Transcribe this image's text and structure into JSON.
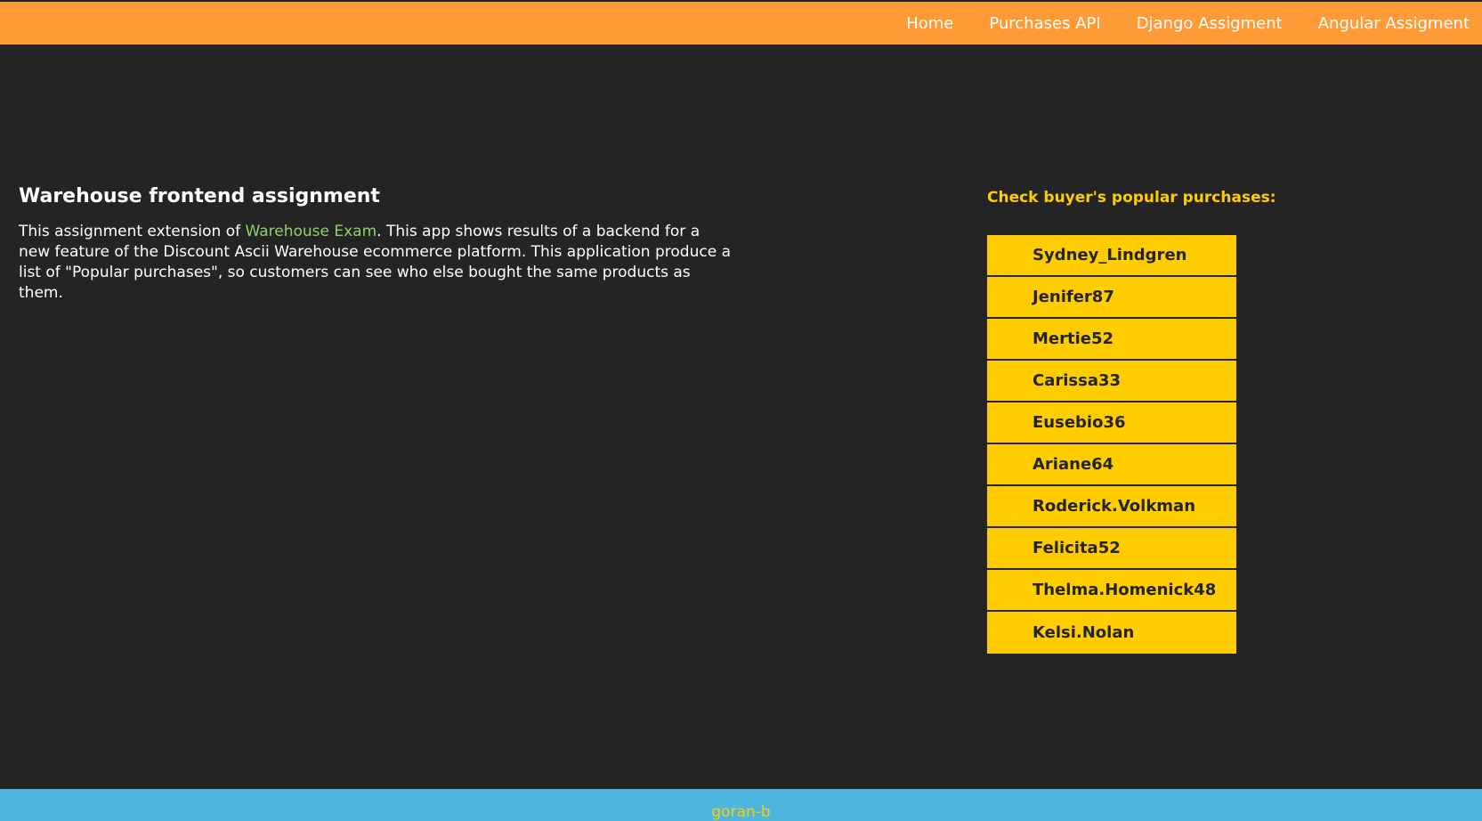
{
  "nav": {
    "items": [
      {
        "label": "Home"
      },
      {
        "label": "Purchases API"
      },
      {
        "label": "Django Assigment"
      },
      {
        "label": "Angular Assigment"
      }
    ]
  },
  "intro": {
    "title": "Warehouse frontend assignment",
    "text_before_link": "This assignment extension of ",
    "link_text": "Warehouse Exam",
    "text_after_link": ". This app shows results of a backend for a new feature of the Discount Ascii Warehouse ecommerce platform. This application produce a list of \"Popular purchases\", so customers can see who else bought the same products as them."
  },
  "buyers": {
    "heading": "Check buyer's popular purchases:",
    "items": [
      {
        "label": "Sydney_Lindgren"
      },
      {
        "label": "Jenifer87"
      },
      {
        "label": "Mertie52"
      },
      {
        "label": "Carissa33"
      },
      {
        "label": "Eusebio36"
      },
      {
        "label": "Ariane64"
      },
      {
        "label": "Roderick.Volkman"
      },
      {
        "label": "Felicita52"
      },
      {
        "label": "Thelma.Homenick48"
      },
      {
        "label": "Kelsi.Nolan"
      }
    ]
  },
  "footer": {
    "text": "goran-b"
  },
  "colors": {
    "navbar": "#ff9b36",
    "background": "#242424",
    "accent": "#ffcc00",
    "link": "#8fd16a",
    "footer": "#4db6de"
  }
}
